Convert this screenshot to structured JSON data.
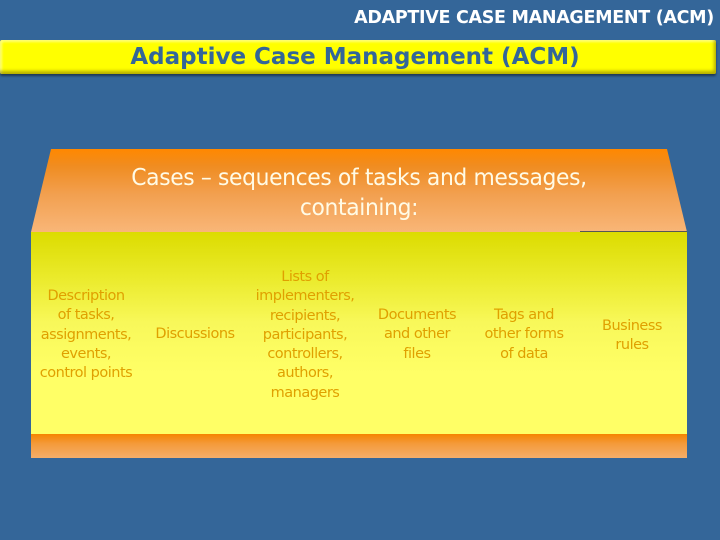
{
  "header": {
    "label": "ADAPTIVE CASE MANAGEMENT (ACM)"
  },
  "title": {
    "text": "Adaptive Case Management (ACM)"
  },
  "cases_banner": {
    "text": "Cases – sequences of tasks and messages,\ncontaining:"
  },
  "items": [
    {
      "label": "Description\nof tasks,\nassignments,\nevents,\ncontrol points"
    },
    {
      "label": "Discussions"
    },
    {
      "label": "Lists of\nimplementers,\nrecipients,\nparticipants,\ncontrollers,\nauthors,\nmanagers"
    },
    {
      "label": "Documents\nand other\nfiles"
    },
    {
      "label": "Tags and\nother forms\nof data"
    },
    {
      "label": "Business\nrules"
    }
  ],
  "colors": {
    "background": "#336699",
    "title_bar": "#ffff00",
    "title_text": "#336699",
    "banner_top": "#ff8800",
    "banner_bottom": "#f8b070",
    "box_top": "#dcdc00",
    "box_bottom": "#ffff66",
    "item_text": "#e0a000"
  }
}
